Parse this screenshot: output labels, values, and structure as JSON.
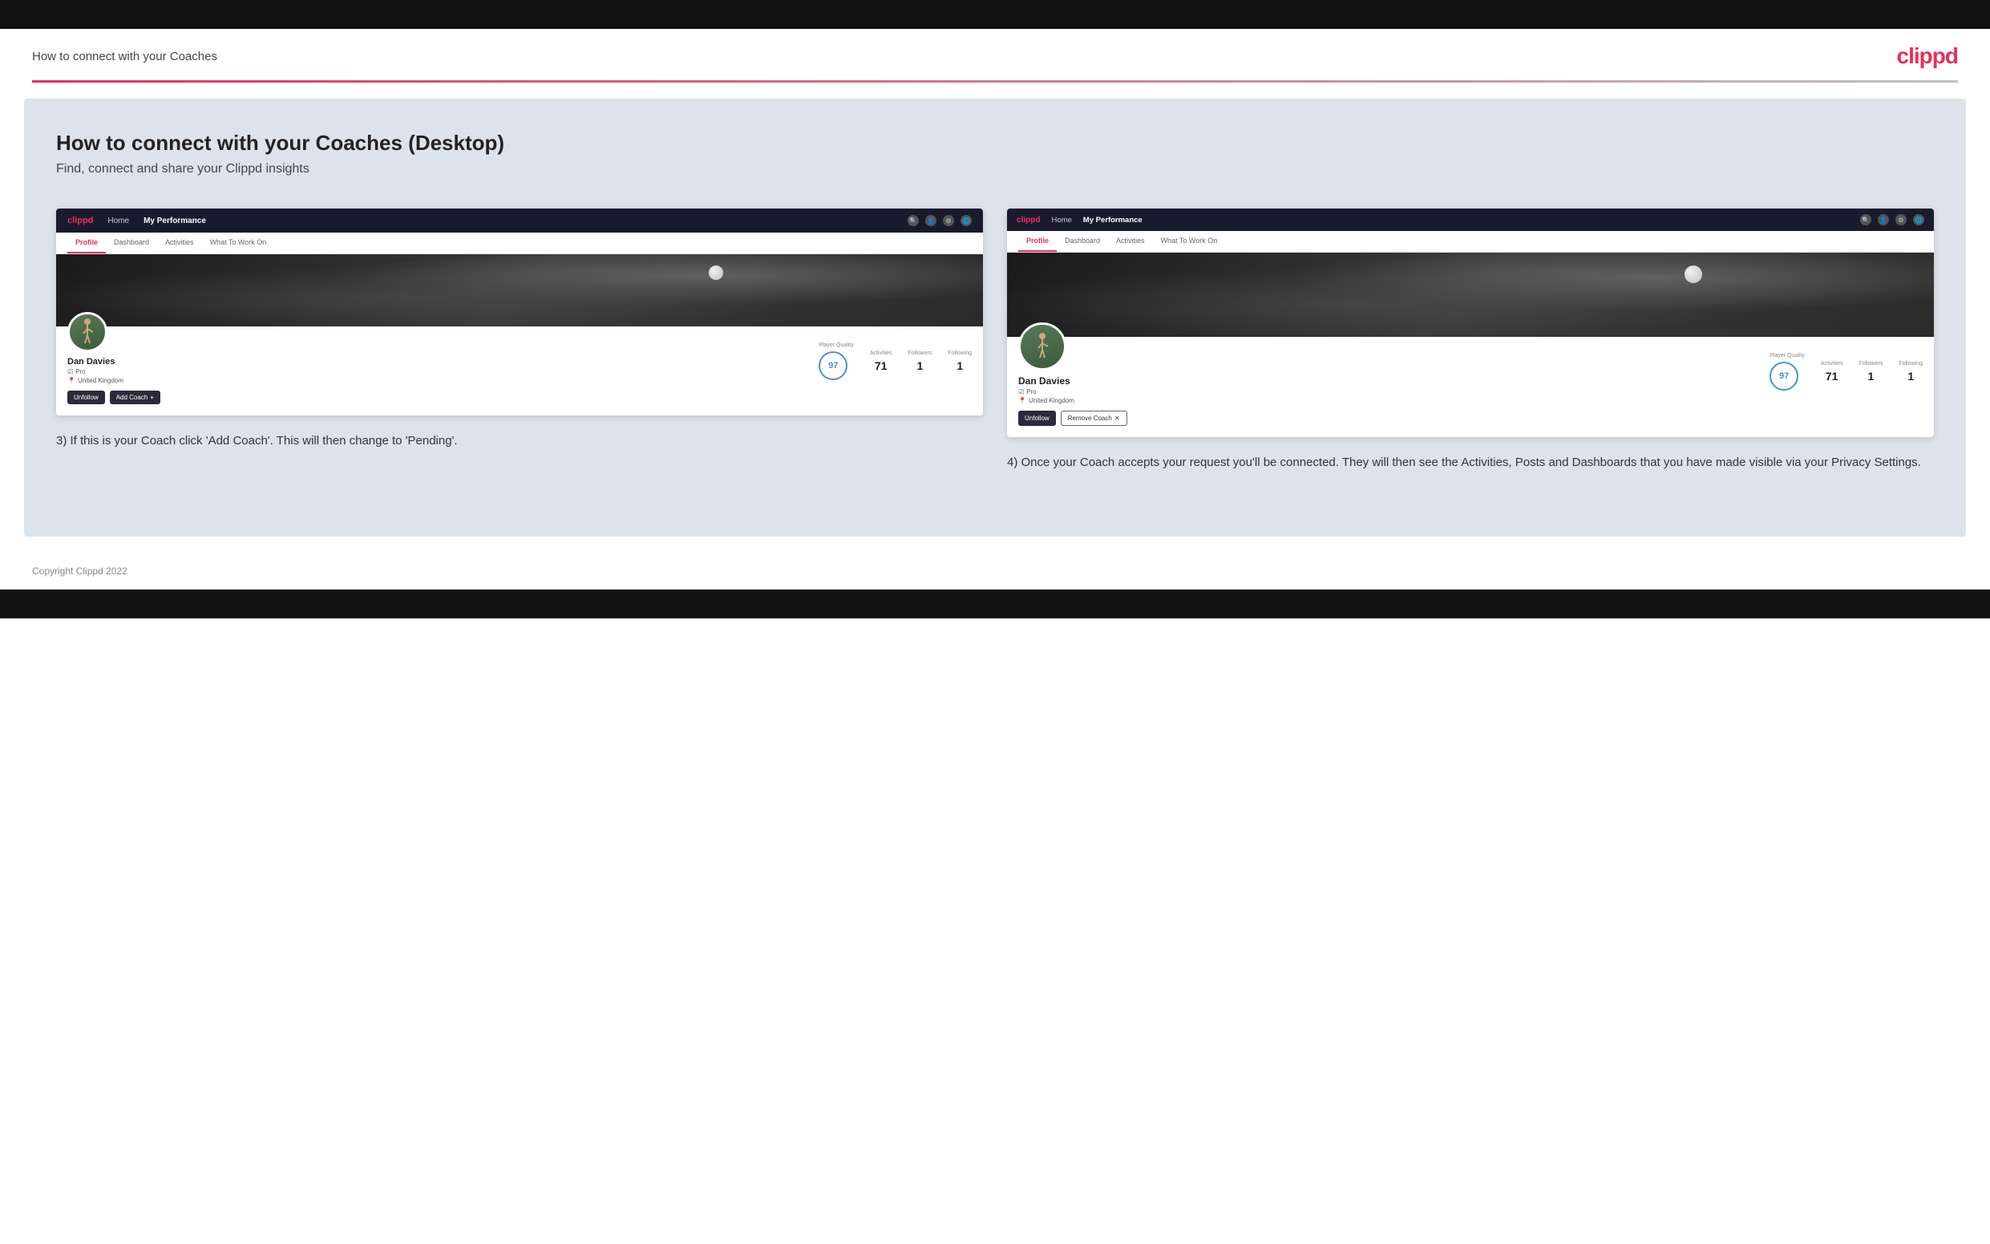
{
  "page": {
    "title": "How to connect with your Coaches",
    "logo": "clippd",
    "footer": "Copyright Clippd 2022"
  },
  "main": {
    "heading": "How to connect with your Coaches (Desktop)",
    "subheading": "Find, connect and share your Clippd insights"
  },
  "screenshot_left": {
    "nav": {
      "logo": "clippd",
      "links": [
        "Home",
        "My Performance"
      ],
      "tabs": [
        "Profile",
        "Dashboard",
        "Activities",
        "What To Work On"
      ]
    },
    "profile": {
      "name": "Dan Davies",
      "role": "Pro",
      "location": "United Kingdom",
      "player_quality": "97",
      "stats": {
        "activities_label": "Activities",
        "activities_value": "71",
        "followers_label": "Followers",
        "followers_value": "1",
        "following_label": "Following",
        "following_value": "1"
      },
      "buttons": [
        "Unfollow",
        "Add Coach"
      ]
    },
    "step": "3) If this is your Coach click 'Add Coach'. This will then change to 'Pending'."
  },
  "screenshot_right": {
    "nav": {
      "logo": "clippd",
      "links": [
        "Home",
        "My Performance"
      ],
      "tabs": [
        "Profile",
        "Dashboard",
        "Activities",
        "What To Work On"
      ]
    },
    "profile": {
      "name": "Dan Davies",
      "role": "Pro",
      "location": "United Kingdom",
      "player_quality": "97",
      "stats": {
        "activities_label": "Activities",
        "activities_value": "71",
        "followers_label": "Followers",
        "followers_value": "1",
        "following_label": "Following",
        "following_value": "1"
      },
      "buttons": [
        "Unfollow",
        "Remove Coach"
      ]
    },
    "step": "4) Once your Coach accepts your request you'll be connected. They will then see the Activities, Posts and Dashboards that you have made visible via your Privacy Settings."
  }
}
